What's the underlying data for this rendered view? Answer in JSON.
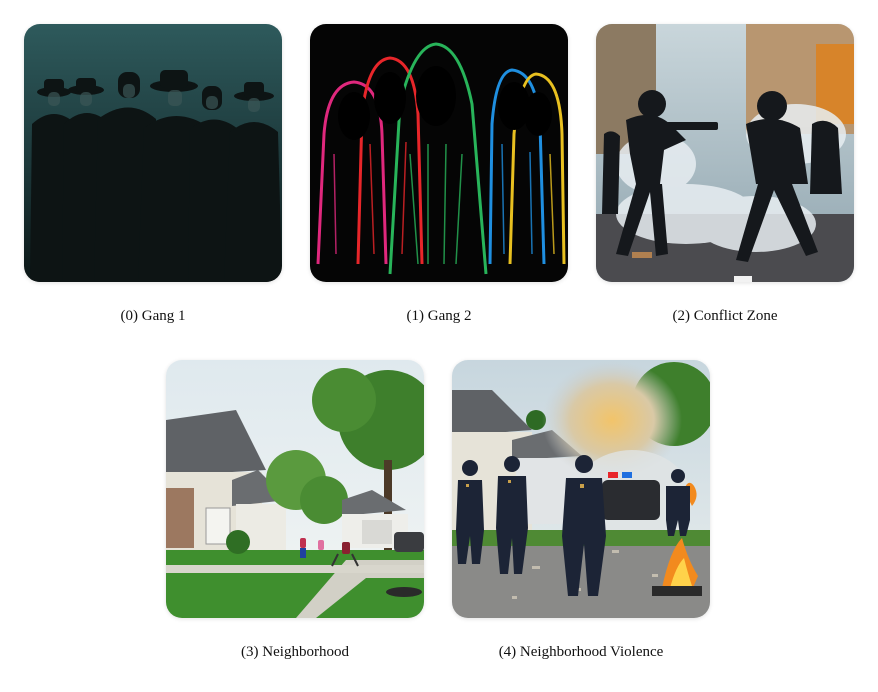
{
  "images": [
    {
      "caption": "(0) Gang 1"
    },
    {
      "caption": "(1) Gang 2"
    },
    {
      "caption": "(2) Conflict Zone"
    },
    {
      "caption": "(3) Neighborhood"
    },
    {
      "caption": "(4) Neighborhood Violence"
    }
  ],
  "colors": {
    "gang1_bg": "#1c3a3c",
    "gang2_hoods": [
      "#e0287d",
      "#e8262a",
      "#28b45a",
      "#1f8fe0",
      "#e8c020"
    ],
    "police_light_red": "#e8262a",
    "police_light_blue": "#1f6fe0"
  }
}
